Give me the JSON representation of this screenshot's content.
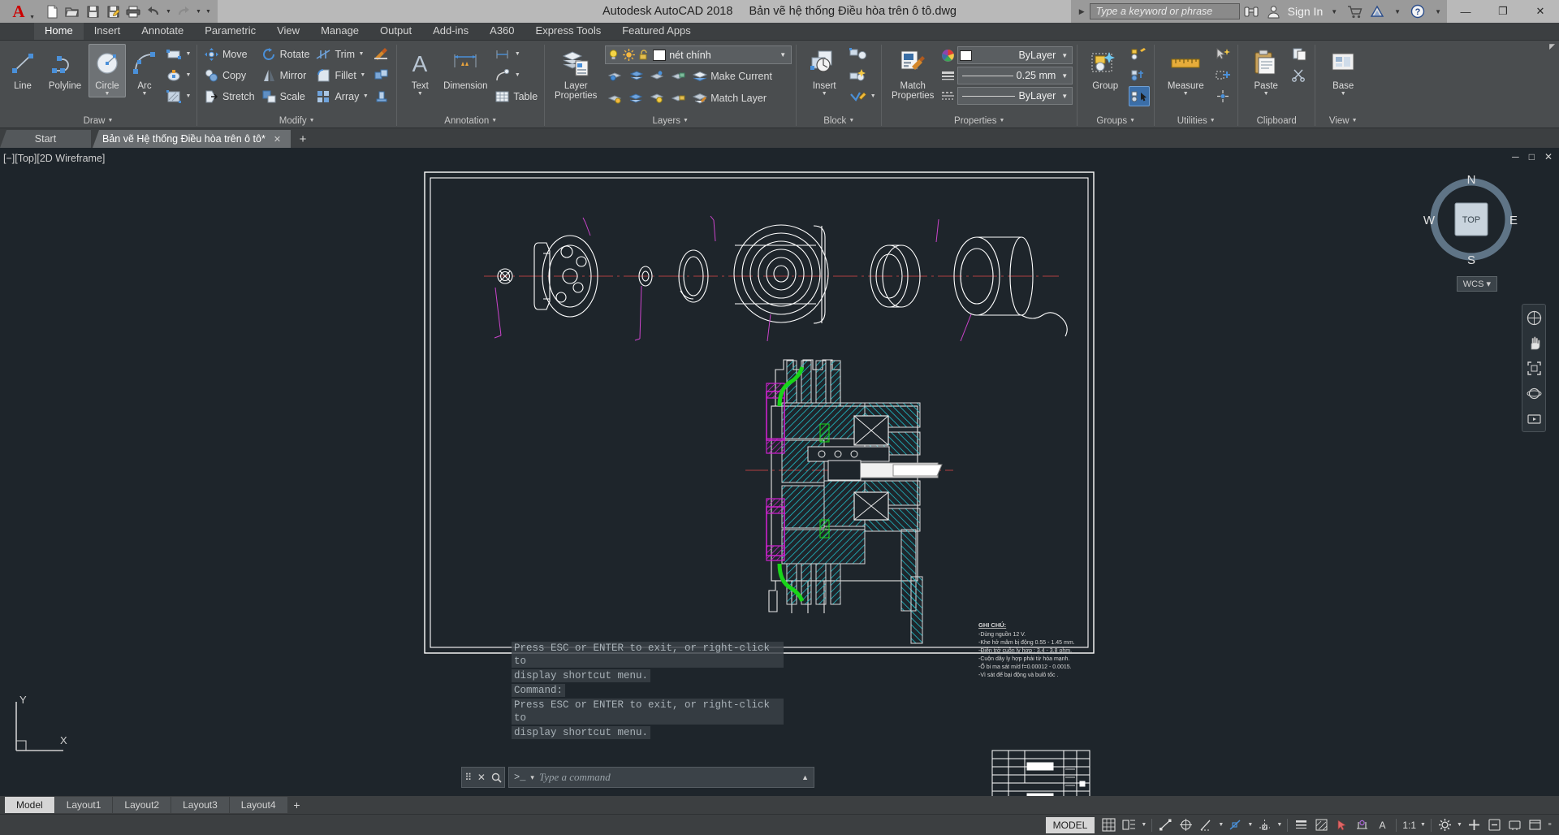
{
  "titlebar": {
    "app_title": "Autodesk AutoCAD 2018",
    "file_name": "Bản vẽ hệ thống Điều hòa trên ô tô.dwg",
    "search_placeholder": "Type a keyword or phrase",
    "sign_in": "Sign In",
    "quick_access": [
      {
        "name": "new-file",
        "icon": "new-document-icon"
      },
      {
        "name": "open-file",
        "icon": "open-folder-icon"
      },
      {
        "name": "save-file",
        "icon": "floppy-save-icon"
      },
      {
        "name": "save-as",
        "icon": "save-as-icon"
      },
      {
        "name": "plot",
        "icon": "printer-icon"
      },
      {
        "name": "undo",
        "icon": "undo-arrow-icon"
      },
      {
        "name": "redo",
        "icon": "redo-arrow-icon"
      },
      {
        "name": "customize",
        "icon": "chevron-down-icon"
      }
    ],
    "window_controls": {
      "minimize": "—",
      "maximize": "❐",
      "close": "✕"
    }
  },
  "ribbon": {
    "tabs": [
      {
        "label": "Home",
        "active": true
      },
      {
        "label": "Insert",
        "active": false
      },
      {
        "label": "Annotate",
        "active": false
      },
      {
        "label": "Parametric",
        "active": false
      },
      {
        "label": "View",
        "active": false
      },
      {
        "label": "Manage",
        "active": false
      },
      {
        "label": "Output",
        "active": false
      },
      {
        "label": "Add-ins",
        "active": false
      },
      {
        "label": "A360",
        "active": false
      },
      {
        "label": "Express Tools",
        "active": false
      },
      {
        "label": "Featured Apps",
        "active": false
      }
    ],
    "panels": {
      "draw": {
        "label": "Draw",
        "line": "Line",
        "polyline": "Polyline",
        "circle": "Circle",
        "arc": "Arc"
      },
      "modify": {
        "label": "Modify",
        "move": "Move",
        "rotate": "Rotate",
        "trim": "Trim",
        "copy": "Copy",
        "mirror": "Mirror",
        "fillet": "Fillet",
        "stretch": "Stretch",
        "scale": "Scale",
        "array": "Array"
      },
      "annotation": {
        "label": "Annotation",
        "text": "Text",
        "dimension": "Dimension",
        "table": "Table"
      },
      "layers": {
        "label": "Layers",
        "layer_properties": "Layer\nProperties",
        "layer_properties_l1": "Layer",
        "layer_properties_l2": "Properties",
        "current_layer": "nét chính",
        "make_current": "Make Current",
        "match_layer": "Match Layer"
      },
      "block": {
        "label": "Block",
        "insert": "Insert"
      },
      "properties": {
        "label": "Properties",
        "match_properties_l1": "Match",
        "match_properties_l2": "Properties",
        "color": "ByLayer",
        "lineweight": "0.25 mm",
        "linetype": "ByLayer"
      },
      "groups": {
        "label": "Groups",
        "group": "Group"
      },
      "utilities": {
        "label": "Utilities",
        "measure": "Measure"
      },
      "clipboard": {
        "label": "Clipboard",
        "paste": "Paste"
      },
      "view": {
        "label": "View",
        "base": "Base"
      }
    }
  },
  "file_tabs": [
    {
      "label": "Start",
      "active": false,
      "closable": false
    },
    {
      "label": "Bản vẽ Hệ thống Điều hòa trên ô tô*",
      "active": true,
      "closable": true
    }
  ],
  "file_tab_add": "+",
  "viewport": {
    "view_label": "[−][Top][2D Wireframe]",
    "window_buttons": {
      "minimize": "─",
      "restore": "□",
      "close": "✕"
    },
    "viewcube": {
      "top": "TOP",
      "north": "N",
      "south": "S",
      "east": "E",
      "west": "W"
    },
    "wcs_label": "WCS",
    "ucs": {
      "x": "X",
      "y": "Y"
    },
    "navbar_icons": [
      "steering-wheel-icon",
      "pan-hand-icon",
      "zoom-extents-icon",
      "orbit-icon",
      "show-motion-icon"
    ]
  },
  "drawing": {
    "notes_title": "GHI CHÚ:",
    "notes": [
      "-Dùng nguồn 12 V.",
      "-Khe hở mâm bị động 0.55 - 1.45 mm.",
      "-Điện trở cuộn ly hợp : 3.4 - 3.8 ohm.",
      "-Cuộn dây ly hợp phải từ hóa mạnh.",
      "-Ổ bi ma sát m/d f=0.00012 - 0.0015.",
      "-Vì sát để bại động và bulô tốc ."
    ]
  },
  "command_line": {
    "history": [
      "Press ESC or ENTER to exit, or right-click to",
      "display shortcut menu.",
      "Command:",
      "Press ESC or ENTER to exit, or right-click to",
      "display shortcut menu."
    ],
    "prompt_symbol": ">_",
    "placeholder": "Type a command",
    "close_icon": "✕",
    "search_icon": "🔍"
  },
  "layout_tabs": [
    {
      "label": "Model",
      "active": true
    },
    {
      "label": "Layout1",
      "active": false
    },
    {
      "label": "Layout2",
      "active": false
    },
    {
      "label": "Layout3",
      "active": false
    },
    {
      "label": "Layout4",
      "active": false
    }
  ],
  "layout_add": "+",
  "status_bar": {
    "model_label": "MODEL",
    "scale": "1:1",
    "items": [
      "grid-display-icon",
      "snap-mode-icon",
      "infer-constraints-icon",
      "ortho-mode-icon",
      "polar-tracking-icon",
      "object-snap-icon",
      "object-snap-tracking-icon",
      "lineweight-icon",
      "transparency-icon",
      "selection-cycling-icon",
      "annotation-monitor-icon",
      "annotation-scale-icon",
      "workspace-gear-icon",
      "customization-icon",
      "isolate-objects-icon",
      "hardware-accel-icon",
      "clean-screen-icon"
    ]
  },
  "colors": {
    "canvas": "#1e252b",
    "ribbon": "#4a4d4f",
    "titlebar": "#b9b9b9",
    "accent_blue": "#3b7dd8",
    "cyan": "#21bdc8",
    "magenta": "#cc22cc",
    "green": "#19d419",
    "red_axis": "#b04040"
  }
}
